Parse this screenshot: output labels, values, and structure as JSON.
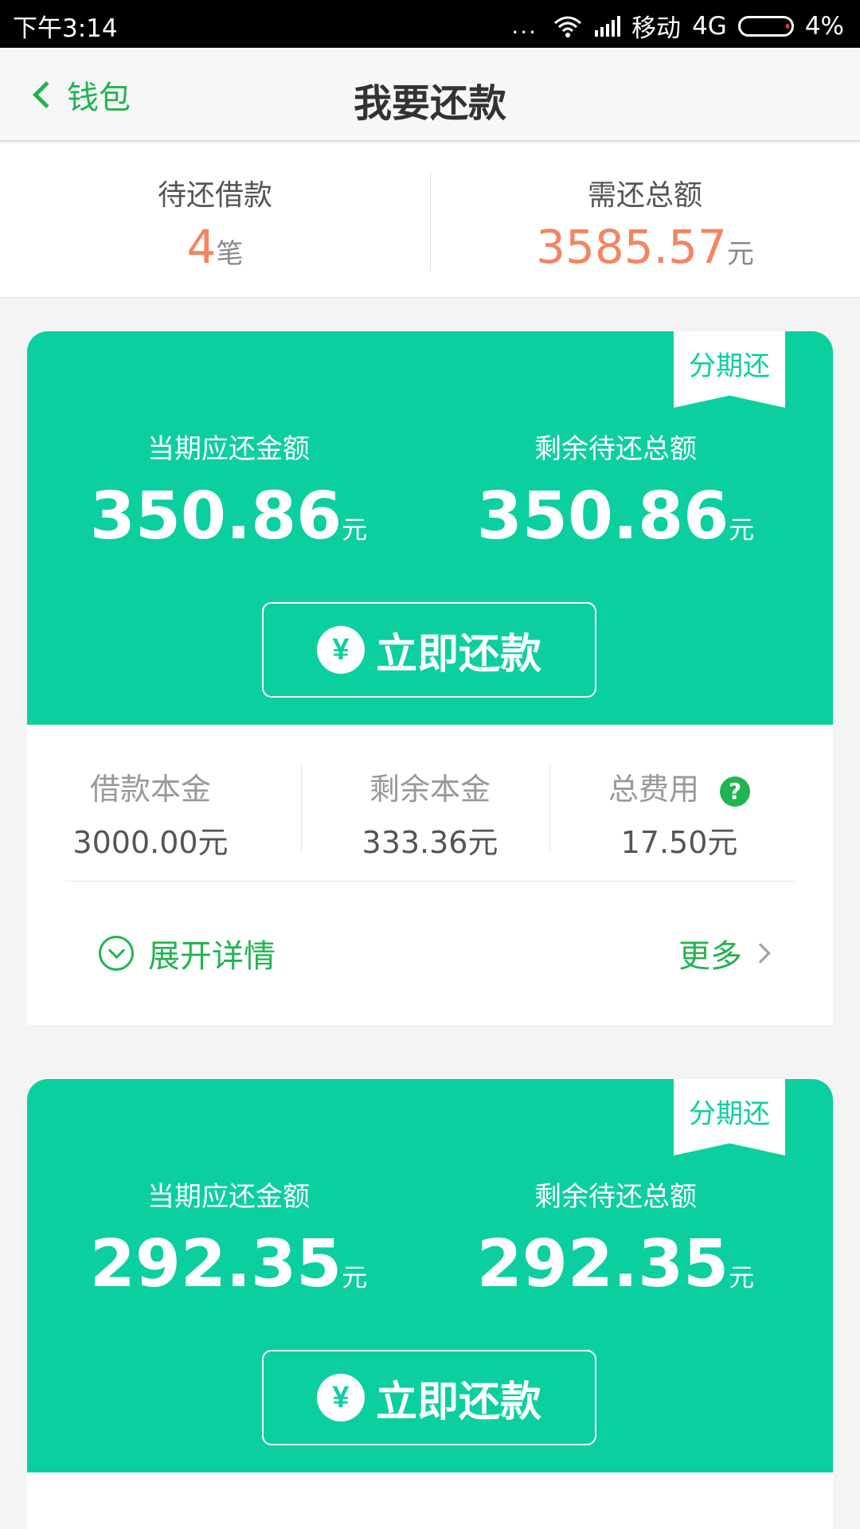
{
  "status_bar": {
    "time": "下午3:14",
    "dots": "...",
    "carrier": "移动",
    "network": "4G",
    "battery": "4%"
  },
  "nav": {
    "back_label": "钱包",
    "title": "我要还款"
  },
  "summary": {
    "pending_label": "待还借款",
    "pending_count": "4",
    "pending_unit": "笔",
    "total_label": "需还总额",
    "total_value": "3585.57",
    "total_unit": "元"
  },
  "cards": [
    {
      "ribbon": "分期还",
      "current_label": "当期应还金额",
      "current_value": "350.86",
      "remaining_label": "剩余待还总额",
      "remaining_value": "350.86",
      "unit": "元",
      "pay_button": "立即还款",
      "yen_symbol": "¥",
      "principal_label": "借款本金",
      "principal_value": "3000.00元",
      "remain_principal_label": "剩余本金",
      "remain_principal_value": "333.36元",
      "fee_label": "总费用",
      "fee_value": "17.50元",
      "help_symbol": "?",
      "expand_label": "展开详情",
      "more_label": "更多"
    },
    {
      "ribbon": "分期还",
      "current_label": "当期应还金额",
      "current_value": "292.35",
      "remaining_label": "剩余待还总额",
      "remaining_value": "292.35",
      "unit": "元",
      "pay_button": "立即还款",
      "yen_symbol": "¥"
    }
  ],
  "colors": {
    "accent_green": "#0ccfa0",
    "link_green": "#21b451",
    "amount_orange": "#f58462"
  }
}
